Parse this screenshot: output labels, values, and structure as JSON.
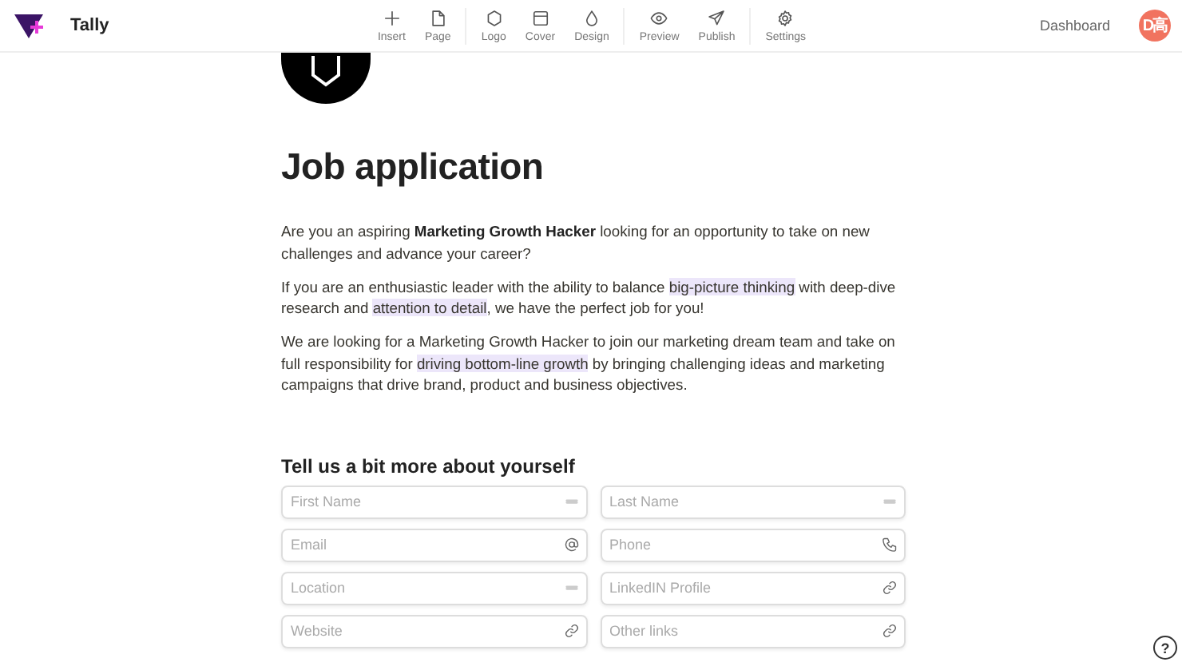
{
  "header": {
    "brand": "Tally",
    "toolbar_groups": [
      [
        {
          "kind": "plus",
          "label": "Insert"
        },
        {
          "kind": "page",
          "label": "Page"
        }
      ],
      [
        {
          "kind": "hexagon",
          "label": "Logo"
        },
        {
          "kind": "window",
          "label": "Cover"
        },
        {
          "kind": "drop",
          "label": "Design"
        }
      ],
      [
        {
          "kind": "eye",
          "label": "Preview"
        },
        {
          "kind": "send",
          "label": "Publish"
        }
      ],
      [
        {
          "kind": "gear",
          "label": "Settings"
        }
      ]
    ],
    "dashboard": "Dashboard",
    "avatar": "D高"
  },
  "form": {
    "title": "Job application",
    "paragraphs": [
      [
        {
          "kind": "plain",
          "text": "Are you an aspiring "
        },
        {
          "kind": "bold",
          "text": "Marketing Growth Hacker"
        },
        {
          "kind": "plain",
          "text": " looking for an opportunity to take on new challenges and advance your career?"
        }
      ],
      [
        {
          "kind": "plain",
          "text": "If you are an enthusiastic leader with the ability to balance "
        },
        {
          "kind": "highlight",
          "text": "big-picture thinking"
        },
        {
          "kind": "plain",
          "text": " with deep-dive research and "
        },
        {
          "kind": "highlight",
          "text": "attention to detail"
        },
        {
          "kind": "plain",
          "text": ", we have the perfect job for you!"
        }
      ],
      [
        {
          "kind": "plain",
          "text": "We are looking for a Marketing Growth Hacker to join our marketing dream team and take on full responsibility for "
        },
        {
          "kind": "highlight",
          "text": "driving bottom-line growth"
        },
        {
          "kind": "plain",
          "text": " by bringing challenging ideas and marketing campaigns that drive brand, product and business objectives."
        }
      ]
    ],
    "section_title": "Tell us a bit more about yourself",
    "fields": [
      {
        "kind": "text",
        "placeholder": "First Name"
      },
      {
        "kind": "text",
        "placeholder": "Last Name"
      },
      {
        "kind": "email",
        "placeholder": "Email"
      },
      {
        "kind": "phone",
        "placeholder": "Phone"
      },
      {
        "kind": "text",
        "placeholder": "Location"
      },
      {
        "kind": "link",
        "placeholder": "LinkedIN Profile"
      },
      {
        "kind": "link",
        "placeholder": "Website"
      },
      {
        "kind": "link",
        "placeholder": "Other links"
      }
    ]
  },
  "help": "?"
}
